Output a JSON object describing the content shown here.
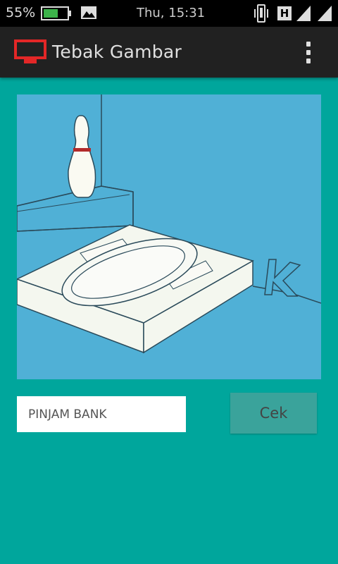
{
  "status_bar": {
    "battery_percent": "55%",
    "time": "Thu, 15:31",
    "network_type": "H",
    "icons": [
      "battery-icon",
      "gallery-icon",
      "vibrate-icon",
      "network-h-icon",
      "signal-icon",
      "signal-icon"
    ]
  },
  "app_bar": {
    "title": "Tebak Gambar",
    "icon": "tv-icon",
    "menu_icon": "overflow-menu-icon"
  },
  "puzzle": {
    "image": "bowling pin on step and squat toilet with letter K",
    "letter": "K"
  },
  "answer": {
    "value": "PINJAM BANK",
    "placeholder": ""
  },
  "check_button": {
    "label": "Cek"
  },
  "colors": {
    "background": "#00a69c",
    "app_bar": "#212121",
    "accent_red": "#e32727",
    "image_bg": "#50b0d6",
    "button": "#3aa39b"
  }
}
